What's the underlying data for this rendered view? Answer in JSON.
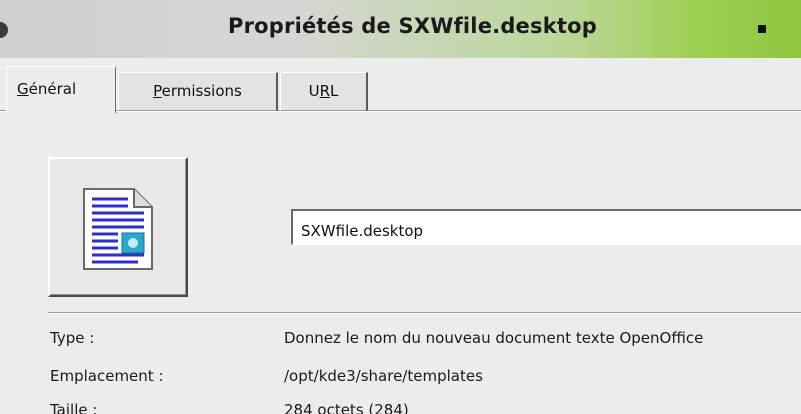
{
  "window": {
    "title": "Propriétés de SXWfile.desktop"
  },
  "tabs": [
    {
      "label": "Général",
      "mnemonic_index": 0,
      "active": true
    },
    {
      "label": "Permissions",
      "mnemonic_index": 0,
      "active": false
    },
    {
      "label": "URL",
      "mnemonic_index": 1,
      "active": false
    }
  ],
  "general": {
    "icon": "document-text-icon",
    "file_name": "SXWfile.desktop",
    "properties": [
      {
        "label": "Type :",
        "value": "Donnez le nom du nouveau document texte OpenOffice"
      },
      {
        "label": "Emplacement :",
        "value": "/opt/kde3/share/templates"
      },
      {
        "label": "Taille :",
        "value": "284 octets (284)"
      }
    ]
  },
  "colors": {
    "titlebar_accent": "#8ec63f",
    "window_bg": "#ececec",
    "doc_lines": "#2e2ec8",
    "doc_badge": "#2aa8c8"
  }
}
